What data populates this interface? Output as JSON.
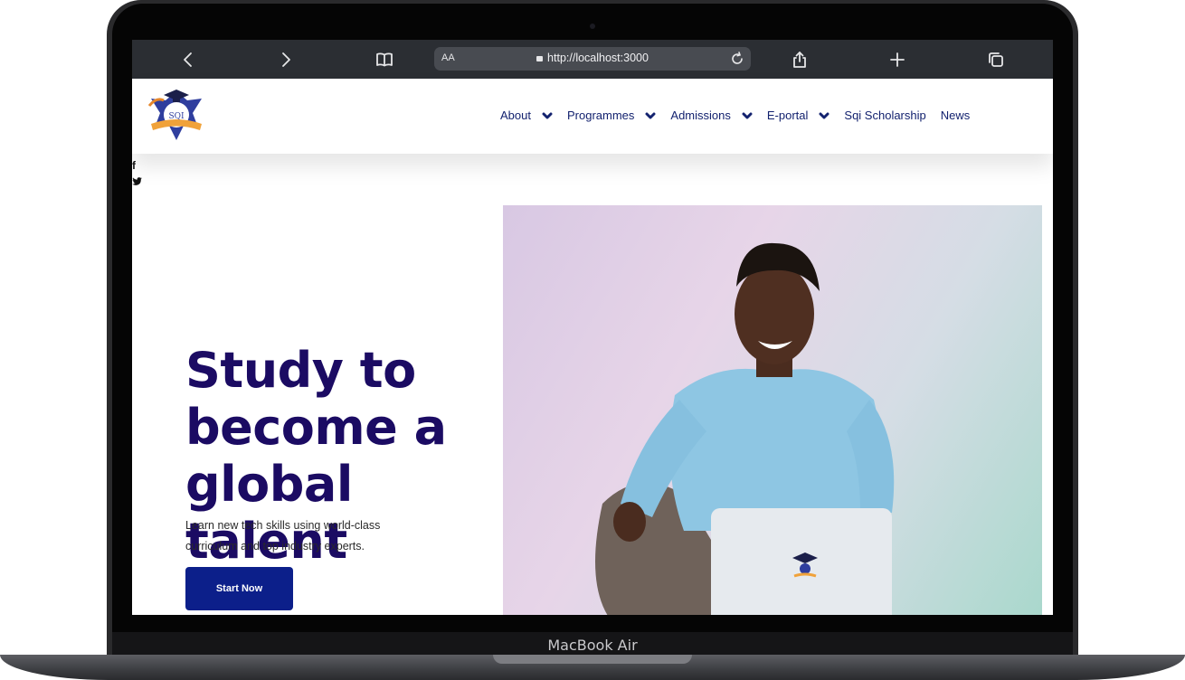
{
  "device": {
    "label": "MacBook Air"
  },
  "browser": {
    "text_size_label": "AA",
    "url": "http://localhost:3000",
    "icons": [
      "back-icon",
      "forward-icon",
      "bookmarks-icon",
      "share-icon",
      "new-tab-icon",
      "tabs-icon",
      "reload-icon",
      "lock-icon"
    ]
  },
  "site": {
    "nav": {
      "about": "About",
      "programmes": "Programmes",
      "admissions": "Admissions",
      "eportal": "E-portal",
      "scholarship": "Sqi Scholarship",
      "news": "News"
    },
    "social": {
      "facebook": "f",
      "twitter": "twitter-icon"
    },
    "hero": {
      "title_line1": "Study to",
      "title_line2": "become a",
      "title_line3": "global talent",
      "subtitle": "Learn new tech skills using world-class curriculum and top industry experts.",
      "cta": "Start Now"
    },
    "logo_text": "SQI",
    "colors": {
      "brand": "#13226f",
      "headline": "#1b0b63",
      "button": "#0c1f8a"
    }
  }
}
